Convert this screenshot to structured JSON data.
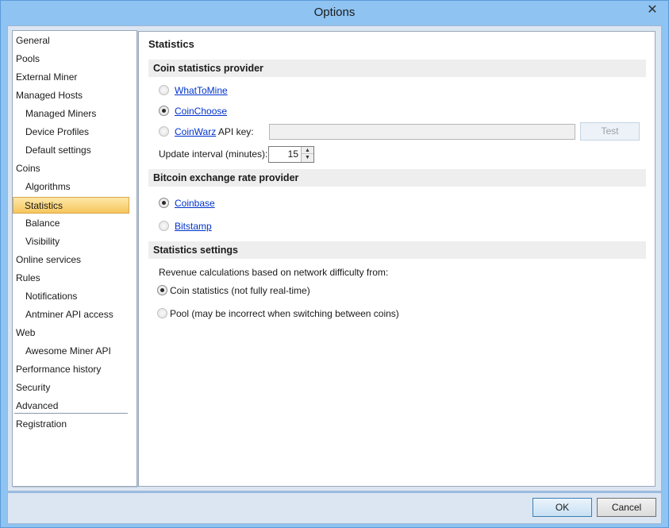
{
  "window": {
    "title": "Options",
    "close_glyph": "✕"
  },
  "sidebar": {
    "items": [
      {
        "label": "General",
        "level": 0
      },
      {
        "label": "Pools",
        "level": 0
      },
      {
        "label": "External Miner",
        "level": 0
      },
      {
        "label": "Managed Hosts",
        "level": 0
      },
      {
        "label": "Managed Miners",
        "level": 1
      },
      {
        "label": "Device Profiles",
        "level": 1
      },
      {
        "label": "Default settings",
        "level": 1
      },
      {
        "label": "Coins",
        "level": 0
      },
      {
        "label": "Algorithms",
        "level": 1
      },
      {
        "label": "Statistics",
        "level": 1,
        "selected": true
      },
      {
        "label": "Balance",
        "level": 1
      },
      {
        "label": "Visibility",
        "level": 1
      },
      {
        "label": "Online services",
        "level": 0
      },
      {
        "label": "Rules",
        "level": 0
      },
      {
        "label": "Notifications",
        "level": 1
      },
      {
        "label": "Antminer API access",
        "level": 1
      },
      {
        "label": "Web",
        "level": 0
      },
      {
        "label": "Awesome Miner API",
        "level": 1
      },
      {
        "label": "Performance history",
        "level": 0
      },
      {
        "label": "Security",
        "level": 0
      },
      {
        "label": "Advanced",
        "level": 0
      },
      {
        "label": "Registration",
        "level": 0
      }
    ]
  },
  "content": {
    "title": "Statistics",
    "coin_provider": {
      "header": "Coin statistics provider",
      "whattomine": "WhatToMine",
      "coinchoose": "CoinChoose",
      "coinwarz": "CoinWarz",
      "coinwarz_suffix": " API key:",
      "api_key_value": "",
      "test_label": "Test",
      "selected": "CoinChoose",
      "update_interval_label": "Update interval (minutes):",
      "update_interval_value": "15"
    },
    "btc_provider": {
      "header": "Bitcoin exchange rate provider",
      "coinbase": "Coinbase",
      "bitstamp": "Bitstamp",
      "selected": "Coinbase"
    },
    "stats_settings": {
      "header": "Statistics settings",
      "description": "Revenue calculations based on network difficulty from:",
      "option_coin": "Coin statistics (not fully real-time)",
      "option_pool": "Pool (may be incorrect when switching between coins)",
      "selected": "Coin statistics"
    }
  },
  "footer": {
    "ok_label": "OK",
    "cancel_label": "Cancel"
  }
}
